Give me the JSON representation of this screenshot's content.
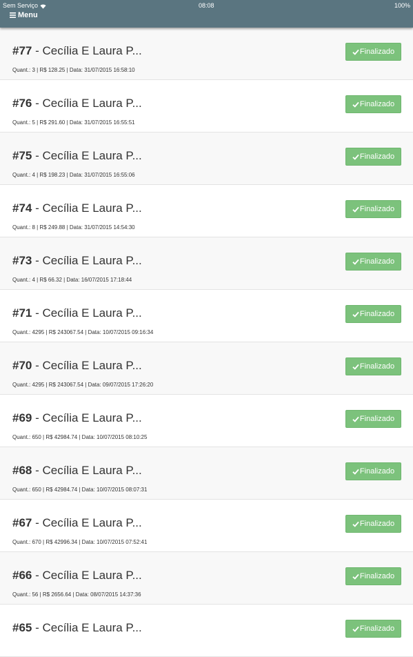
{
  "statusbar": {
    "carrier": "Sem Serviço",
    "time": "08:08",
    "battery": "100%"
  },
  "nav": {
    "menu_label": "Menu"
  },
  "orders": [
    {
      "number": "#77",
      "customer": " - Cecília E Laura P...",
      "details": "Quant.: 3 | R$ 128.25 | Data: 31/07/2015 16:58:10",
      "status": "Finalizado"
    },
    {
      "number": "#76",
      "customer": " - Cecília E Laura P...",
      "details": "Quant.: 5 | R$ 291.60 | Data: 31/07/2015 16:55:51",
      "status": "Finalizado"
    },
    {
      "number": "#75",
      "customer": " - Cecília E Laura P...",
      "details": "Quant.: 4 | R$ 198.23 | Data: 31/07/2015 16:55:06",
      "status": "Finalizado"
    },
    {
      "number": "#74",
      "customer": " - Cecília E Laura P...",
      "details": "Quant.: 8 | R$ 249.88 | Data: 31/07/2015 14:54:30",
      "status": "Finalizado"
    },
    {
      "number": "#73",
      "customer": " - Cecília E Laura P...",
      "details": "Quant.: 4 | R$ 66.32 | Data: 16/07/2015 17:18:44",
      "status": "Finalizado"
    },
    {
      "number": "#71",
      "customer": " - Cecília E Laura P...",
      "details": "Quant.: 4295 | R$ 243067.54 | Data: 10/07/2015 09:16:34",
      "status": "Finalizado"
    },
    {
      "number": "#70",
      "customer": " - Cecília E Laura P...",
      "details": "Quant.: 4295 | R$ 243067.54 | Data: 09/07/2015 17:26:20",
      "status": "Finalizado"
    },
    {
      "number": "#69",
      "customer": " - Cecília E Laura P...",
      "details": "Quant.: 650 | R$ 42984.74 | Data: 10/07/2015 08:10:25",
      "status": "Finalizado"
    },
    {
      "number": "#68",
      "customer": " - Cecília E Laura P...",
      "details": "Quant.: 650 | R$ 42984.74 | Data: 10/07/2015 08:07:31",
      "status": "Finalizado"
    },
    {
      "number": "#67",
      "customer": " - Cecília E Laura P...",
      "details": "Quant.: 670 | R$ 42996.34 | Data: 10/07/2015 07:52:41",
      "status": "Finalizado"
    },
    {
      "number": "#66",
      "customer": " - Cecília E Laura P...",
      "details": "Quant.: 56 | R$ 2656.64 | Data: 08/07/2015 14:37:36",
      "status": "Finalizado"
    },
    {
      "number": "#65",
      "customer": " - Cecília E Laura P...",
      "details": "",
      "status": "Finalizado"
    }
  ]
}
